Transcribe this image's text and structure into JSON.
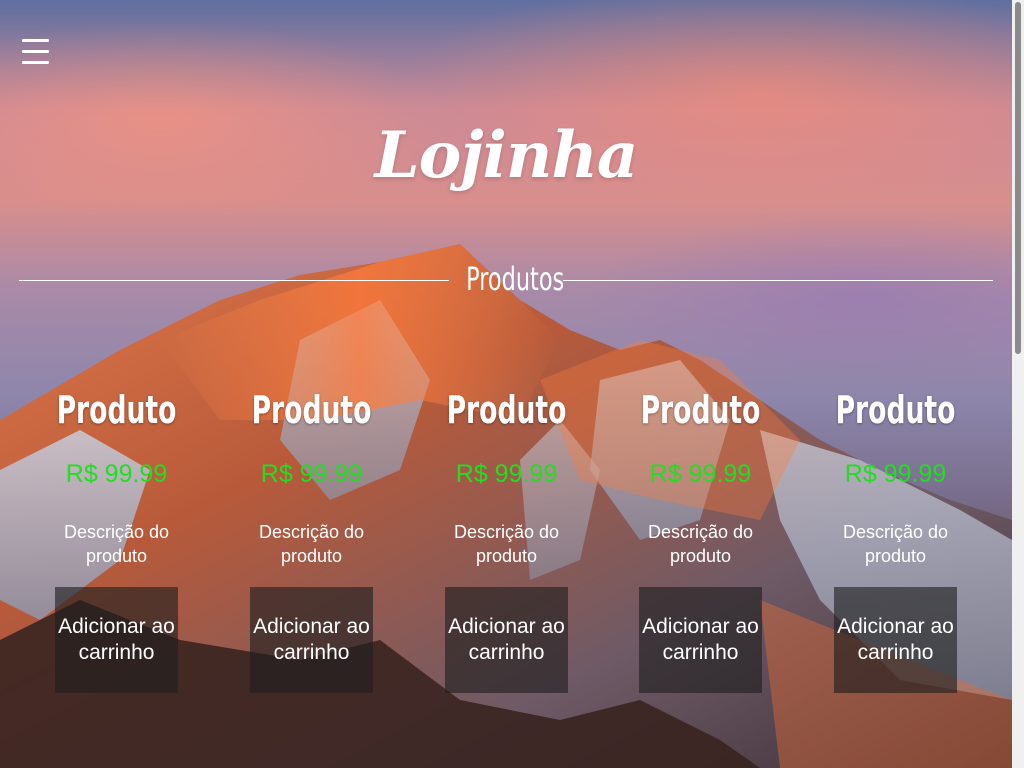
{
  "header": {
    "menu_icon": "hamburger-menu-icon",
    "logo_text": "Lojinha"
  },
  "section": {
    "title": "Produtos"
  },
  "products": [
    {
      "name": "Produto",
      "price": "R$ 99.99",
      "description": "Descrição do produto",
      "button_label": "Adicionar ao carrinho"
    },
    {
      "name": "Produto",
      "price": "R$ 99.99",
      "description": "Descrição do produto",
      "button_label": "Adicionar ao carrinho"
    },
    {
      "name": "Produto",
      "price": "R$ 99.99",
      "description": "Descrição do produto",
      "button_label": "Adicionar ao carrinho"
    },
    {
      "name": "Produto",
      "price": "R$ 99.99",
      "description": "Descrição do produto",
      "button_label": "Adicionar ao carrinho"
    },
    {
      "name": "Produto",
      "price": "R$ 99.99",
      "description": "Descrição do produto",
      "button_label": "Adicionar ao carrinho"
    }
  ],
  "colors": {
    "price": "#22dd22",
    "text": "#ffffff",
    "button_bg": "rgba(30,30,30,0.62)"
  }
}
